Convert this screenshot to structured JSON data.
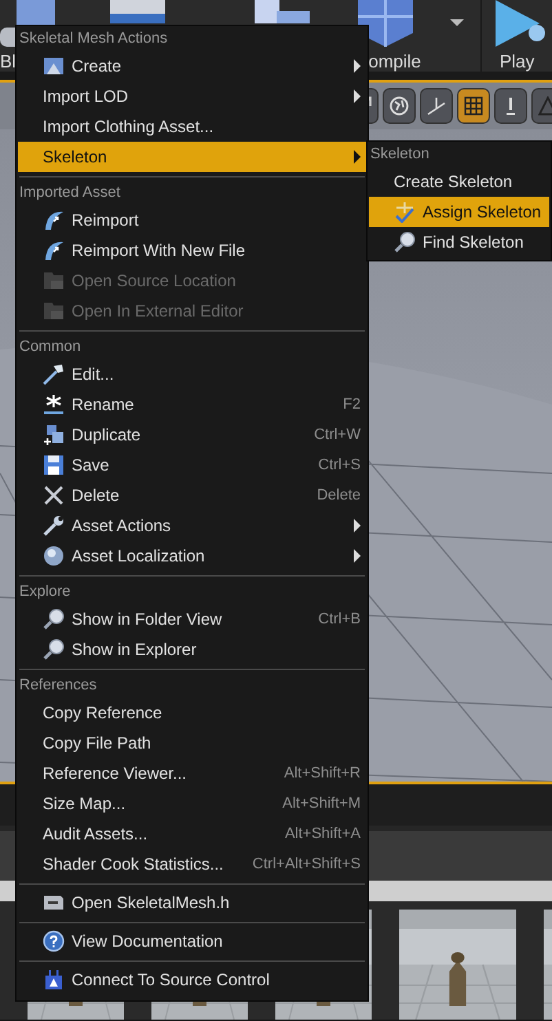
{
  "toolbar": [
    {
      "label": "Bl"
    },
    {
      "label": "ompile"
    },
    {
      "label": "Play"
    }
  ],
  "viewport_tools": [
    {
      "selected": false
    },
    {
      "selected": false
    },
    {
      "selected": false
    },
    {
      "selected": true
    },
    {
      "selected": false
    },
    {
      "selected": false
    }
  ],
  "context_menu": {
    "sections": [
      {
        "header": "Skeletal Mesh Actions",
        "items": [
          {
            "label": "Create",
            "submenu": true,
            "disabled": false,
            "selected": false
          },
          {
            "label": "Import LOD",
            "submenu": true,
            "disabled": false,
            "selected": false
          },
          {
            "label": "Import Clothing Asset...",
            "submenu": false,
            "disabled": false,
            "selected": false
          },
          {
            "label": "Skeleton",
            "submenu": true,
            "disabled": false,
            "selected": true
          }
        ]
      },
      {
        "header": "Imported Asset",
        "items": [
          {
            "label": "Reimport",
            "submenu": false,
            "disabled": false,
            "selected": false
          },
          {
            "label": "Reimport With New File",
            "submenu": false,
            "disabled": false,
            "selected": false
          },
          {
            "label": "Open Source Location",
            "submenu": false,
            "disabled": true,
            "selected": false
          },
          {
            "label": "Open In External Editor",
            "submenu": false,
            "disabled": true,
            "selected": false
          }
        ]
      },
      {
        "header": "Common",
        "items": [
          {
            "label": "Edit...",
            "submenu": false,
            "disabled": false,
            "selected": false
          },
          {
            "label": "Rename",
            "shortcut": "F2",
            "submenu": false,
            "disabled": false,
            "selected": false
          },
          {
            "label": "Duplicate",
            "shortcut": "Ctrl+W",
            "submenu": false,
            "disabled": false,
            "selected": false
          },
          {
            "label": "Save",
            "shortcut": "Ctrl+S",
            "submenu": false,
            "disabled": false,
            "selected": false
          },
          {
            "label": "Delete",
            "shortcut": "Delete",
            "submenu": false,
            "disabled": false,
            "selected": false
          },
          {
            "label": "Asset Actions",
            "submenu": true,
            "disabled": false,
            "selected": false
          },
          {
            "label": "Asset Localization",
            "submenu": true,
            "disabled": false,
            "selected": false
          }
        ]
      },
      {
        "header": "Explore",
        "items": [
          {
            "label": "Show in Folder View",
            "shortcut": "Ctrl+B",
            "submenu": false,
            "disabled": false,
            "selected": false
          },
          {
            "label": "Show in Explorer",
            "submenu": false,
            "disabled": false,
            "selected": false
          }
        ]
      },
      {
        "header": "References",
        "items": [
          {
            "label": "Copy Reference",
            "submenu": false,
            "disabled": false,
            "selected": false
          },
          {
            "label": "Copy File Path",
            "submenu": false,
            "disabled": false,
            "selected": false
          },
          {
            "label": "Reference Viewer...",
            "shortcut": "Alt+Shift+R",
            "submenu": false,
            "disabled": false,
            "selected": false
          },
          {
            "label": "Size Map...",
            "shortcut": "Alt+Shift+M",
            "submenu": false,
            "disabled": false,
            "selected": false
          },
          {
            "label": "Audit Assets...",
            "shortcut": "Alt+Shift+A",
            "submenu": false,
            "disabled": false,
            "selected": false
          },
          {
            "label": "Shader Cook Statistics...",
            "shortcut": "Ctrl+Alt+Shift+S",
            "submenu": false,
            "disabled": false,
            "selected": false
          }
        ]
      },
      {
        "items": [
          {
            "label": "Open SkeletalMesh.h",
            "submenu": false,
            "disabled": false,
            "selected": false
          }
        ]
      },
      {
        "items": [
          {
            "label": "View Documentation",
            "submenu": false,
            "disabled": false,
            "selected": false
          }
        ]
      },
      {
        "items": [
          {
            "label": "Connect To Source Control",
            "submenu": false,
            "disabled": false,
            "selected": false
          }
        ]
      }
    ]
  },
  "submenu": {
    "header": "Skeleton",
    "items": [
      {
        "label": "Create Skeleton",
        "selected": false
      },
      {
        "label": "Assign Skeleton",
        "selected": true
      },
      {
        "label": "Find Skeleton",
        "selected": false
      }
    ]
  }
}
